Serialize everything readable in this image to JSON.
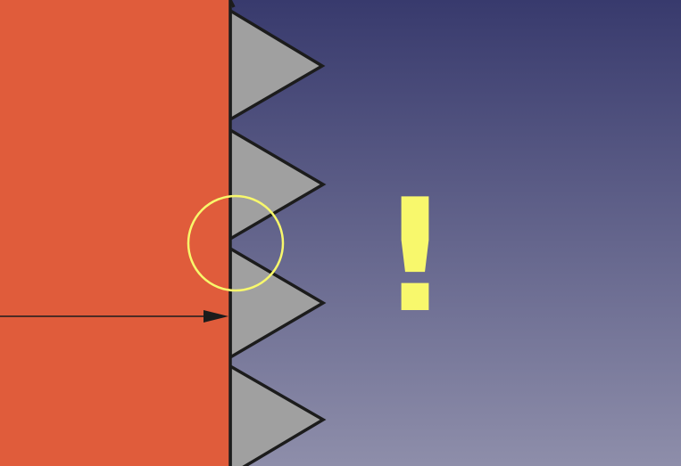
{
  "viewport": {
    "background_top": "#383a6d",
    "background_bottom": "#8e8eaa"
  },
  "solid_body": {
    "color": "#e05c3b"
  },
  "thread_profile": {
    "fill": "#a0a0a0",
    "stroke": "#1c1c1c",
    "tooth_count": 4
  },
  "dimension_arrow": {
    "color": "#1c1c1c"
  },
  "highlight_marker": {
    "color": "#f8f86c"
  },
  "warning_marker": {
    "symbol": "!",
    "color": "#f8f86c"
  }
}
